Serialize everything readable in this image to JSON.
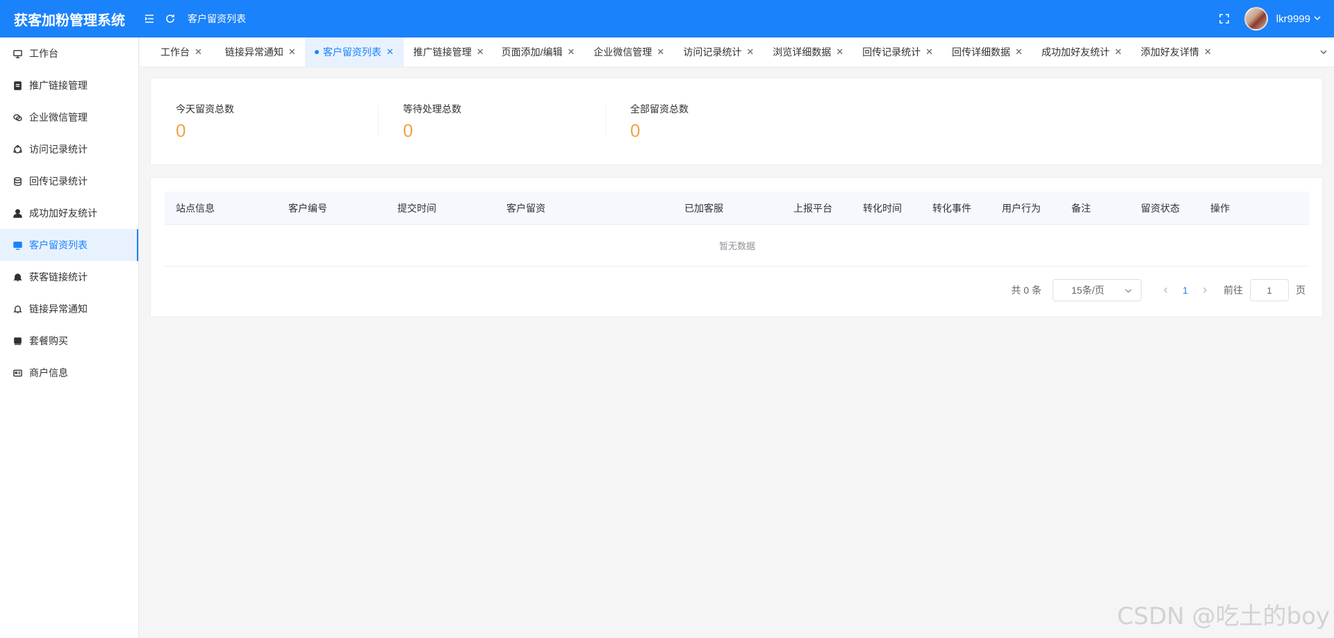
{
  "header": {
    "app_title": "获客加粉管理系统",
    "breadcrumb": "客户留资列表",
    "username": "lkr9999"
  },
  "sidebar": {
    "items": [
      {
        "label": "工作台",
        "icon": "monitor-icon"
      },
      {
        "label": "推广链接管理",
        "icon": "document-icon"
      },
      {
        "label": "企业微信管理",
        "icon": "wechat-icon"
      },
      {
        "label": "访问记录统计",
        "icon": "cycle-icon"
      },
      {
        "label": "回传记录统计",
        "icon": "database-icon"
      },
      {
        "label": "成功加好友统计",
        "icon": "user-icon"
      },
      {
        "label": "客户留资列表",
        "icon": "screen-icon",
        "active": true
      },
      {
        "label": "获客链接统计",
        "icon": "bell-filled-icon"
      },
      {
        "label": "链接异常通知",
        "icon": "bell-icon"
      },
      {
        "label": "套餐购买",
        "icon": "box-icon"
      },
      {
        "label": "商户信息",
        "icon": "id-card-icon"
      }
    ]
  },
  "tabs": [
    {
      "label": "工作台"
    },
    {
      "label": "链接异常通知"
    },
    {
      "label": "客户留资列表",
      "active": true
    },
    {
      "label": "推广链接管理"
    },
    {
      "label": "页面添加/编辑"
    },
    {
      "label": "企业微信管理"
    },
    {
      "label": "访问记录统计"
    },
    {
      "label": "浏览详细数据"
    },
    {
      "label": "回传记录统计"
    },
    {
      "label": "回传详细数据"
    },
    {
      "label": "成功加好友统计"
    },
    {
      "label": "添加好友详情"
    }
  ],
  "stats": [
    {
      "label": "今天留资总数",
      "value": "0"
    },
    {
      "label": "等待处理总数",
      "value": "0"
    },
    {
      "label": "全部留资总数",
      "value": "0"
    }
  ],
  "table": {
    "columns": [
      "站点信息",
      "客户编号",
      "提交时间",
      "客户留资",
      "已加客服",
      "上报平台",
      "转化时间",
      "转化事件",
      "用户行为",
      "备注",
      "留资状态",
      "操作"
    ],
    "empty_text": "暂无数据"
  },
  "pagination": {
    "total": "共 0 条",
    "page_size": "15条/页",
    "current_page": "1",
    "goto_label": "前往",
    "goto_value": "1",
    "page_unit": "页"
  },
  "watermark": "CSDN @吃土的boy",
  "colors": {
    "primary": "#1a82fb",
    "stat_value": "#f0a24a"
  }
}
